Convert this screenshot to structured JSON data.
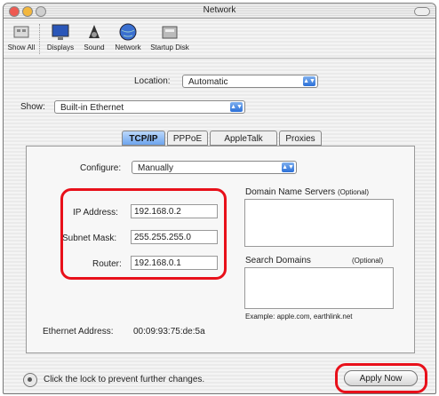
{
  "window": {
    "title": "Network"
  },
  "toolbar": {
    "items": [
      {
        "label": "Show All",
        "icon": "show-all-icon"
      },
      {
        "label": "Displays",
        "icon": "displays-icon"
      },
      {
        "label": "Sound",
        "icon": "sound-icon"
      },
      {
        "label": "Network",
        "icon": "network-icon"
      },
      {
        "label": "Startup Disk",
        "icon": "startup-disk-icon"
      }
    ]
  },
  "location": {
    "label": "Location:",
    "value": "Automatic"
  },
  "show": {
    "label": "Show:",
    "value": "Built-in Ethernet"
  },
  "tabs": [
    {
      "label": "TCP/IP",
      "selected": true
    },
    {
      "label": "PPPoE",
      "selected": false
    },
    {
      "label": "AppleTalk",
      "selected": false
    },
    {
      "label": "Proxies",
      "selected": false
    }
  ],
  "configure": {
    "label": "Configure:",
    "value": "Manually"
  },
  "ip": {
    "label": "IP Address:",
    "value": "192.168.0.2"
  },
  "subnet": {
    "label": "Subnet Mask:",
    "value": "255.255.255.0"
  },
  "router": {
    "label": "Router:",
    "value": "192.168.0.1"
  },
  "dns": {
    "label": "Domain Name Servers",
    "optional": "(Optional)"
  },
  "search": {
    "label": "Search Domains",
    "optional": "(Optional)"
  },
  "example": "Example: apple.com, earthlink.net",
  "ethernet": {
    "label": "Ethernet Address:",
    "value": "00:09:93:75:de:5a"
  },
  "lock_text": "Click the lock to prevent further changes.",
  "apply_label": "Apply Now",
  "colors": {
    "highlight_red": "#e8101a",
    "tab_blue": "#6da4ee"
  }
}
